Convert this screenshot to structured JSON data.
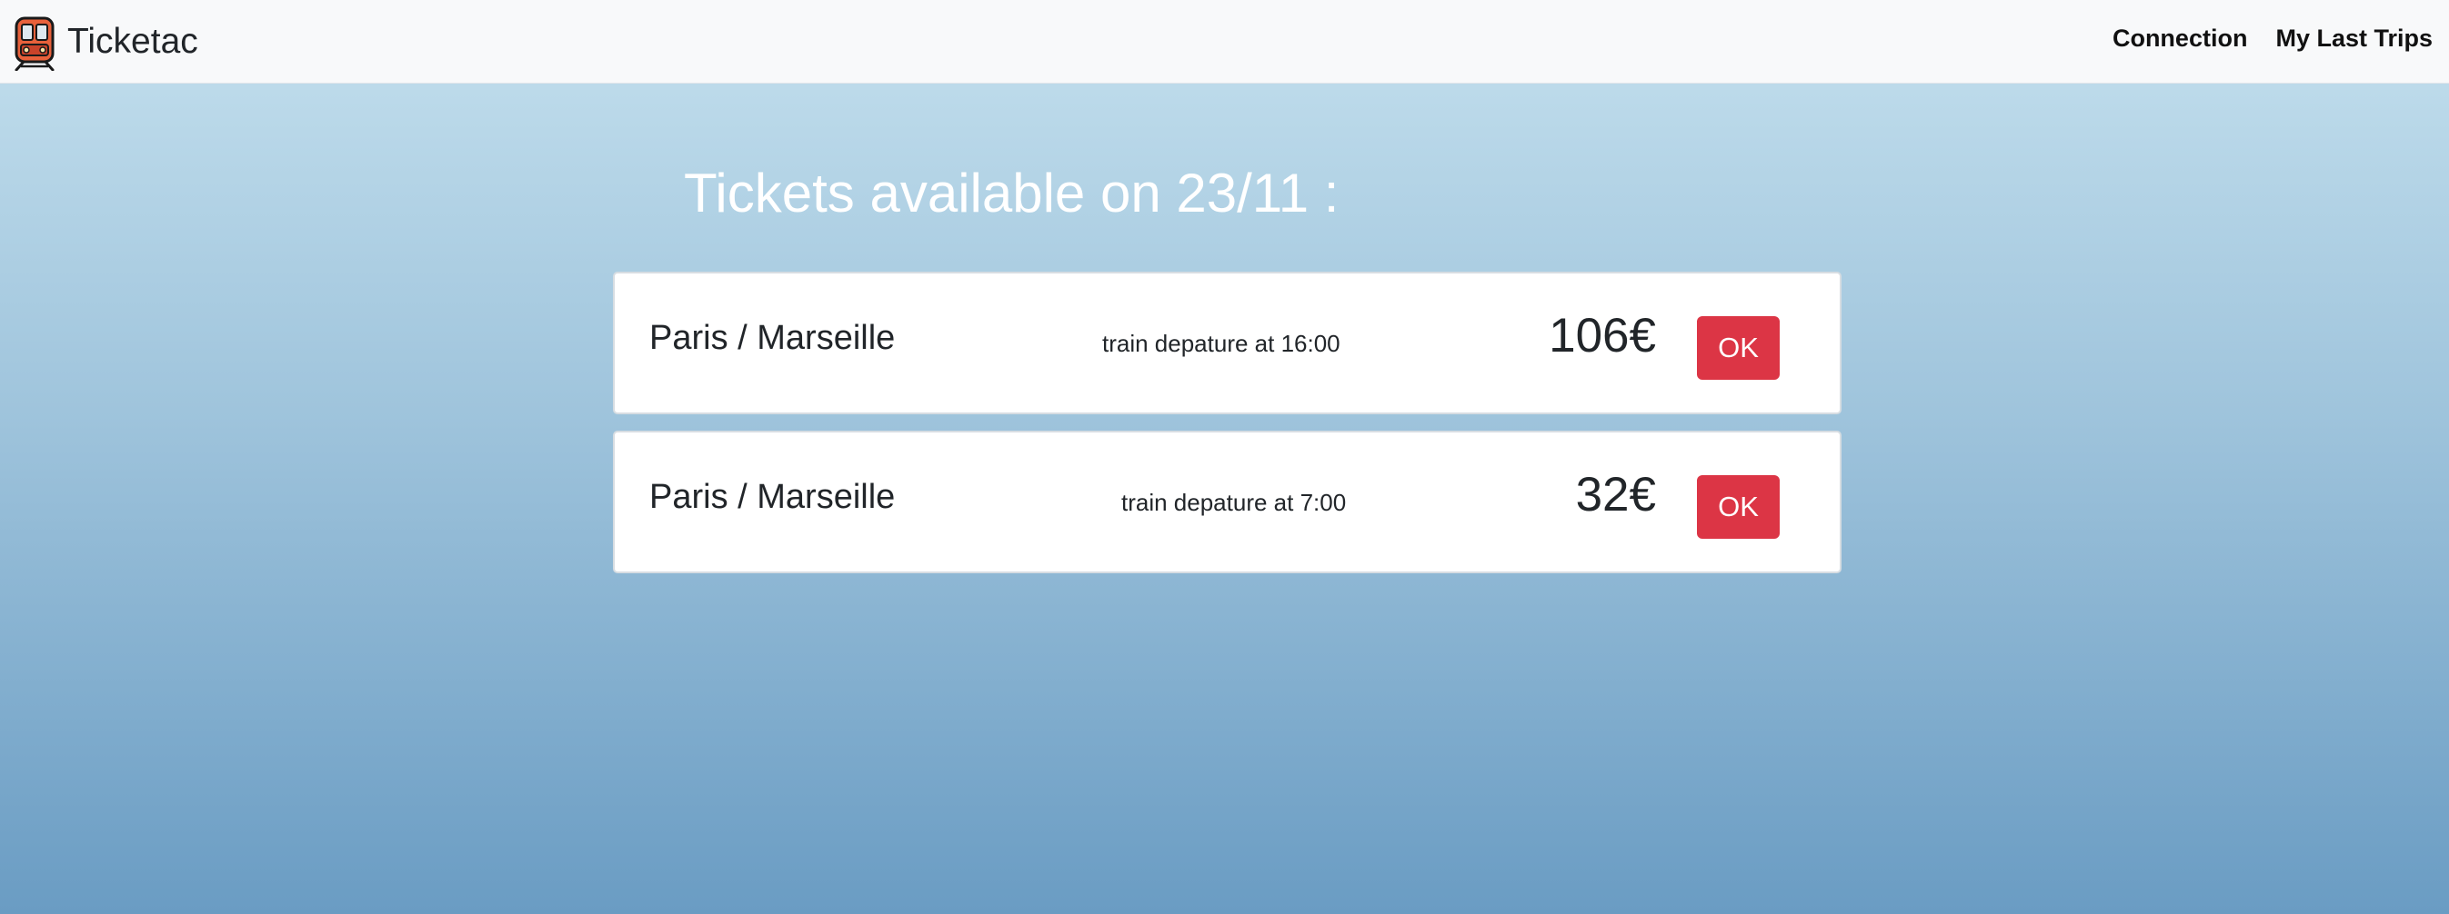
{
  "navbar": {
    "brand_label": "Ticketac",
    "brand_icon": "train-icon",
    "links": [
      {
        "label": "Connection"
      },
      {
        "label": "My Last Trips"
      }
    ]
  },
  "main": {
    "heading": "Tickets available on 23/11 :",
    "tickets": [
      {
        "route": "Paris / Marseille",
        "departure": "train depature at 16:00",
        "price": "106€",
        "button_label": "OK"
      },
      {
        "route": "Paris / Marseille",
        "departure": "train depature at 7:00",
        "price": "32€",
        "button_label": "OK"
      }
    ]
  },
  "colors": {
    "navbar_bg": "#f8f9fa",
    "button_bg": "#dc3545",
    "gradient_top": "#c4e0ee",
    "gradient_bottom": "#6a9cc3"
  }
}
